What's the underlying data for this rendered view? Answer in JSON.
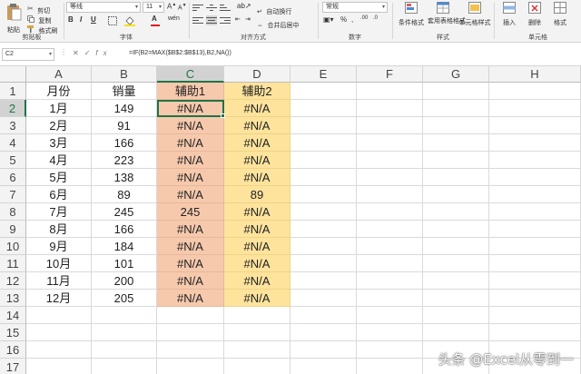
{
  "ribbon": {
    "clipboard": {
      "paste": "粘贴",
      "cut": "剪切",
      "copy": "复制",
      "format_painter": "格式刷",
      "group_label": "剪贴板"
    },
    "font": {
      "font_name": "等线",
      "font_size": "11",
      "group_label": "字体"
    },
    "alignment": {
      "wrap_text": "自动换行",
      "merge_center": "合并后居中",
      "group_label": "对齐方式"
    },
    "number": {
      "format": "常规",
      "group_label": "数字"
    },
    "styles": {
      "conditional": "条件格式",
      "table_format": "套用表格格式",
      "cell_styles": "单元格样式",
      "group_label": "样式"
    },
    "cells": {
      "insert": "插入",
      "delete": "删除",
      "format": "格式",
      "group_label": "单元格"
    }
  },
  "formula_bar": {
    "name_box": "C2",
    "formula": "=IF(B2=MAX($B$2:$B$13),B2,NA())"
  },
  "sheet": {
    "columns": [
      "A",
      "B",
      "C",
      "D",
      "E",
      "F",
      "G",
      "H"
    ],
    "rows": [
      "1",
      "2",
      "3",
      "4",
      "5",
      "6",
      "7",
      "8",
      "9",
      "10",
      "11",
      "12",
      "13",
      "14",
      "15",
      "16",
      "17"
    ],
    "header": {
      "a": "月份",
      "b": "销量",
      "c": "辅助1",
      "d": "辅助2"
    },
    "data": [
      {
        "a": "1月",
        "b": "149",
        "c": "#N/A",
        "d": "#N/A"
      },
      {
        "a": "2月",
        "b": "91",
        "c": "#N/A",
        "d": "#N/A"
      },
      {
        "a": "3月",
        "b": "166",
        "c": "#N/A",
        "d": "#N/A"
      },
      {
        "a": "4月",
        "b": "223",
        "c": "#N/A",
        "d": "#N/A"
      },
      {
        "a": "5月",
        "b": "138",
        "c": "#N/A",
        "d": "#N/A"
      },
      {
        "a": "6月",
        "b": "89",
        "c": "#N/A",
        "d": "89"
      },
      {
        "a": "7月",
        "b": "245",
        "c": "245",
        "d": "#N/A"
      },
      {
        "a": "8月",
        "b": "166",
        "c": "#N/A",
        "d": "#N/A"
      },
      {
        "a": "9月",
        "b": "184",
        "c": "#N/A",
        "d": "#N/A"
      },
      {
        "a": "10月",
        "b": "101",
        "c": "#N/A",
        "d": "#N/A"
      },
      {
        "a": "11月",
        "b": "200",
        "c": "#N/A",
        "d": "#N/A"
      },
      {
        "a": "12月",
        "b": "205",
        "c": "#N/A",
        "d": "#N/A"
      }
    ],
    "colors": {
      "c_fill": "#f6c9ad",
      "d_fill": "#fde39c",
      "selection": "#217346"
    }
  },
  "watermark": "头条 @Excel从零到一"
}
